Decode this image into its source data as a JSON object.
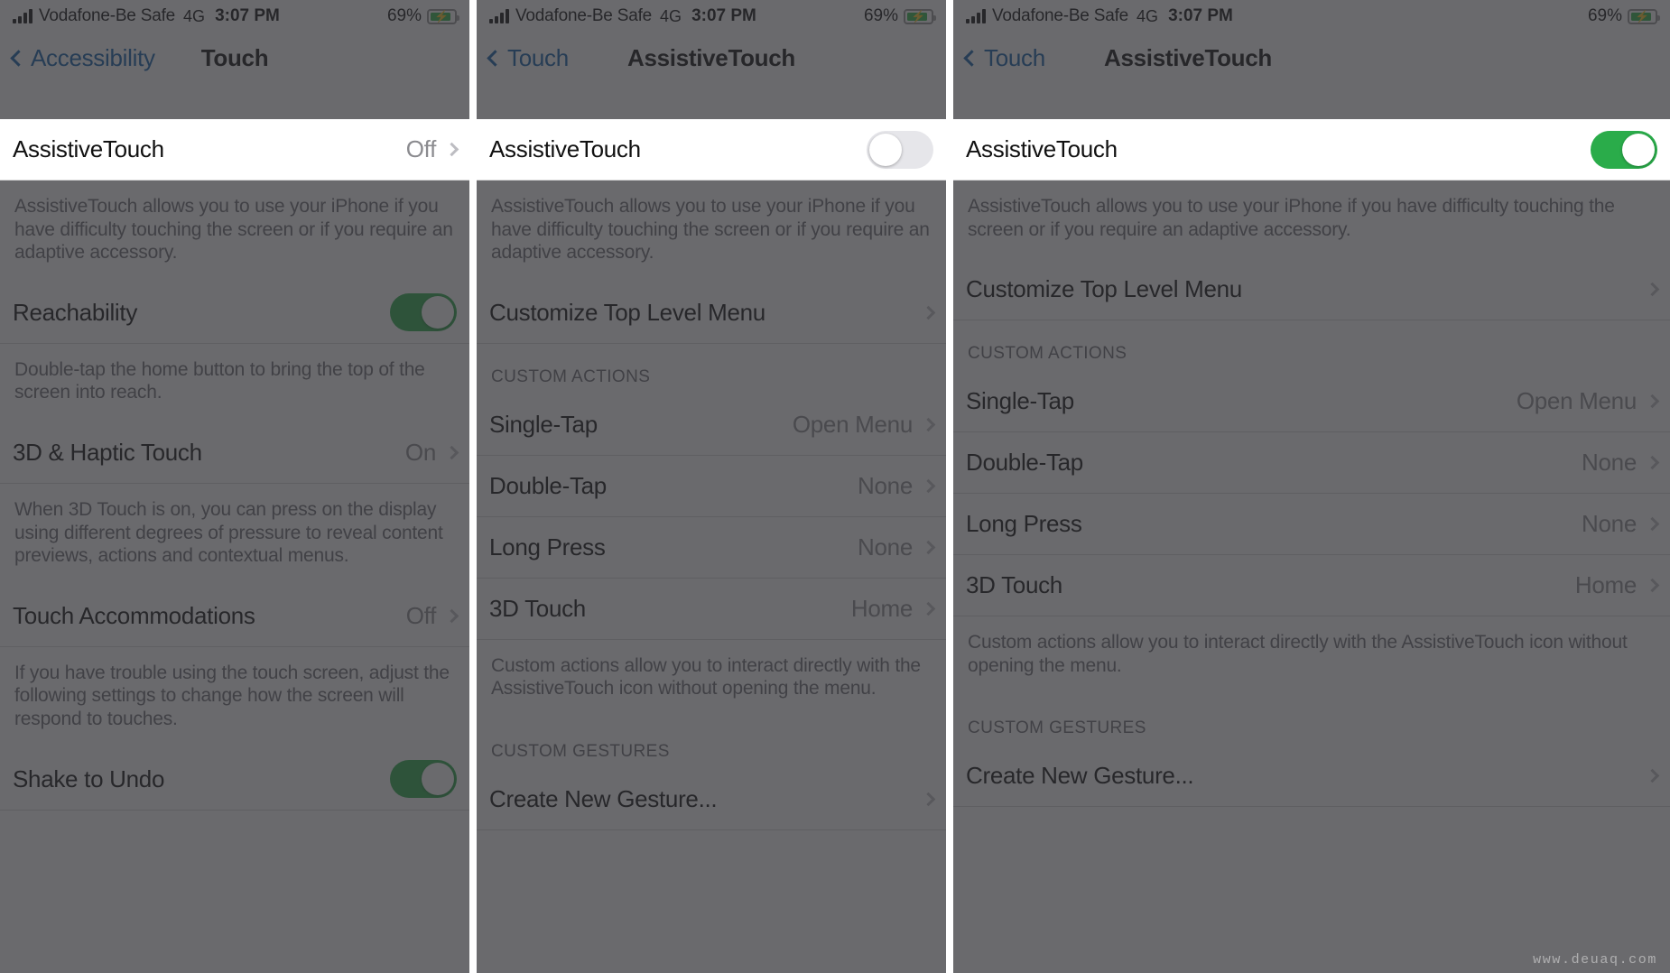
{
  "watermark": "www.deuaq.com",
  "status": {
    "carrier": "Vodafone-Be Safe",
    "network": "4G",
    "time": "3:07 PM",
    "battery_pct": "69%",
    "battery_icon": "battery-charging-icon",
    "signal_icon": "signal-bars-icon"
  },
  "panels": [
    {
      "nav": {
        "back_label": "Accessibility",
        "back_icon": "chevron-left-icon",
        "title": "Touch"
      },
      "rows": [
        {
          "label": "AssistiveTouch",
          "value": "Off",
          "accessory": "chevron",
          "highlight": true
        },
        {
          "footnote": "AssistiveTouch allows you to use your iPhone if you have difficulty touching the screen or if you require an adaptive accessory."
        },
        {
          "label": "Reachability",
          "accessory": "toggle",
          "toggle_on": true
        },
        {
          "footnote": "Double-tap the home button to bring the top of the screen into reach."
        },
        {
          "label": "3D & Haptic Touch",
          "value": "On",
          "accessory": "chevron"
        },
        {
          "footnote": "When 3D Touch is on, you can press on the display using different degrees of pressure to reveal content previews, actions and contextual menus."
        },
        {
          "label": "Touch Accommodations",
          "value": "Off",
          "accessory": "chevron"
        },
        {
          "footnote": "If you have trouble using the touch screen, adjust the following settings to change how the screen will respond to touches."
        },
        {
          "label": "Shake to Undo",
          "accessory": "toggle",
          "toggle_on": true
        }
      ]
    },
    {
      "nav": {
        "back_label": "Touch",
        "back_icon": "chevron-left-icon",
        "title": "AssistiveTouch"
      },
      "rows": [
        {
          "label": "AssistiveTouch",
          "accessory": "toggle",
          "toggle_on": false,
          "highlight": true
        },
        {
          "footnote": "AssistiveTouch allows you to use your iPhone if you have difficulty touching the screen or if you require an adaptive accessory."
        },
        {
          "label": "Customize Top Level Menu",
          "accessory": "chevron"
        },
        {
          "section": "CUSTOM ACTIONS"
        },
        {
          "label": "Single-Tap",
          "value": "Open Menu",
          "accessory": "chevron"
        },
        {
          "label": "Double-Tap",
          "value": "None",
          "accessory": "chevron"
        },
        {
          "label": "Long Press",
          "value": "None",
          "accessory": "chevron"
        },
        {
          "label": "3D Touch",
          "value": "Home",
          "accessory": "chevron"
        },
        {
          "footnote": "Custom actions allow you to interact directly with the AssistiveTouch icon without opening the menu."
        },
        {
          "section": "CUSTOM GESTURES"
        },
        {
          "label": "Create New Gesture...",
          "accessory": "chevron"
        }
      ]
    },
    {
      "nav": {
        "back_label": "Touch",
        "back_icon": "chevron-left-icon",
        "title": "AssistiveTouch"
      },
      "rows": [
        {
          "label": "AssistiveTouch",
          "accessory": "toggle",
          "toggle_on": true,
          "highlight": true
        },
        {
          "footnote": "AssistiveTouch allows you to use your iPhone if you have difficulty touching the screen or if you require an adaptive accessory."
        },
        {
          "label": "Customize Top Level Menu",
          "accessory": "chevron"
        },
        {
          "section": "CUSTOM ACTIONS"
        },
        {
          "label": "Single-Tap",
          "value": "Open Menu",
          "accessory": "chevron"
        },
        {
          "label": "Double-Tap",
          "value": "None",
          "accessory": "chevron"
        },
        {
          "label": "Long Press",
          "value": "None",
          "accessory": "chevron"
        },
        {
          "label": "3D Touch",
          "value": "Home",
          "accessory": "chevron"
        },
        {
          "footnote": "Custom actions allow you to interact directly with the AssistiveTouch icon without opening the menu."
        },
        {
          "section": "CUSTOM GESTURES"
        },
        {
          "label": "Create New Gesture...",
          "accessory": "chevron"
        }
      ]
    }
  ],
  "colors": {
    "toggle_on": "#2aac4a",
    "toggle_off": "#e6e6ea",
    "link": "#0f5ea8",
    "dim": "rgba(48,48,52,.72)",
    "value_gray": "#8b8b8f"
  }
}
